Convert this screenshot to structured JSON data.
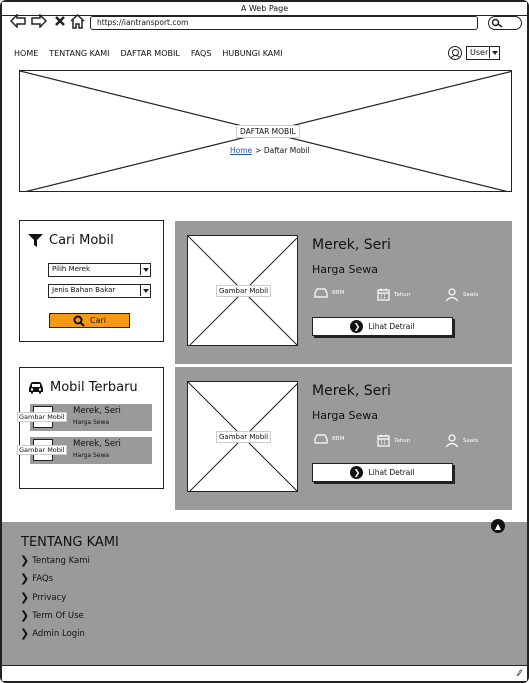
{
  "window": {
    "title": "A Web Page"
  },
  "browser": {
    "url": "https://iantransport.com"
  },
  "nav": {
    "items": [
      "HOME",
      "TENTANG KAMI",
      "DAFTAR MOBIL",
      "FAQS",
      "HUBUNGI KAMI"
    ],
    "user_label": "User"
  },
  "hero": {
    "title": "DAFTAR MOBIL",
    "breadcrumb_home": "Home",
    "breadcrumb_sep": ">",
    "breadcrumb_current": "Daftar Mobil"
  },
  "filter": {
    "title": "Cari Mobil",
    "select_brand": "Pilih Merek",
    "select_fuel": "Jenis Bahan Bakar",
    "button": "Cari"
  },
  "latest": {
    "title": "Mobil Terbaru",
    "items": [
      {
        "image_label": "Gambar Mobil",
        "title": "Merek, Seri",
        "price": "Harga Sewa"
      },
      {
        "image_label": "Gambar Mobil",
        "title": "Merek, Seri",
        "price": "Harga Sewa"
      }
    ]
  },
  "cars": [
    {
      "image_label": "Gambar Mobil",
      "title": "Merek, Seri",
      "price": "Harga Sewa",
      "spec_fuel": "BBM",
      "spec_year": "Tahun",
      "spec_seats": "Seats",
      "button": "Lihat Detrail"
    },
    {
      "image_label": "Gambar Mobil",
      "title": "Merek, Seri",
      "price": "Harga Sewa",
      "spec_fuel": "BBM",
      "spec_year": "Tahun",
      "spec_seats": "Seats",
      "button": "Lihat Detrail"
    }
  ],
  "footer": {
    "title": "TENTANG KAMI",
    "links": [
      "Tentang Kami",
      "FAQs",
      "Prrivacy",
      "Term Of Use",
      "Admin Login"
    ]
  },
  "colors": {
    "panel_gray": "#9a9a9a",
    "search_button": "#f59a12",
    "link_blue": "#2255aa"
  },
  "icons": [
    "back-arrow-icon",
    "forward-arrow-icon",
    "close-icon",
    "home-icon",
    "search-icon",
    "user-icon",
    "filter-icon",
    "car-icon",
    "fuel-icon",
    "calendar-icon",
    "person-icon",
    "chevron-right-icon",
    "chevron-up-icon"
  ]
}
